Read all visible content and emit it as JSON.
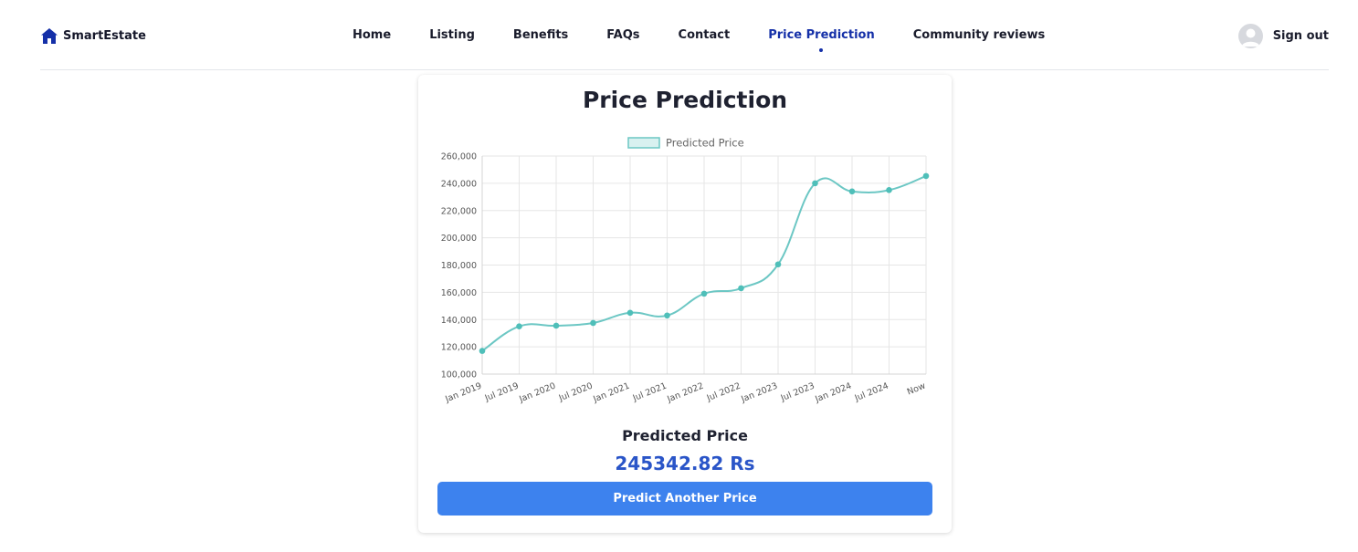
{
  "brand": {
    "name": "SmartEstate",
    "icon": "house-icon",
    "color": "#1530a8"
  },
  "nav": {
    "items": [
      {
        "label": "Home"
      },
      {
        "label": "Listing"
      },
      {
        "label": "Benefits"
      },
      {
        "label": "FAQs"
      },
      {
        "label": "Contact"
      },
      {
        "label": "Price Prediction",
        "active": true
      },
      {
        "label": "Community reviews"
      }
    ]
  },
  "user": {
    "avatar_icon": "user-avatar-icon",
    "signout_label": "Sign out"
  },
  "card": {
    "title": "Price Prediction",
    "predicted_label": "Predicted Price",
    "predicted_value": "245342.82 Rs",
    "button_label": "Predict Another Price"
  },
  "colors": {
    "accent": "#1530a8",
    "button": "#3d82ee",
    "value_text": "#2a55c8",
    "series_line": "#6cc7c4",
    "series_point": "#4fbfb9"
  },
  "chart_data": {
    "type": "line",
    "categories": [
      "Jan 2019",
      "Jul 2019",
      "Jan 2020",
      "Jul 2020",
      "Jan 2021",
      "Jul 2021",
      "Jan 2022",
      "Jul 2022",
      "Jan 2023",
      "Jul 2023",
      "Jan 2024",
      "Jul 2024",
      "Now"
    ],
    "series": [
      {
        "name": "Predicted Price",
        "values": [
          117000,
          135000,
          135500,
          137500,
          145000,
          143000,
          159000,
          163000,
          180500,
          240000,
          234000,
          235000,
          245342.82
        ]
      }
    ],
    "ylim": [
      100000,
      260000
    ],
    "yticks": [
      100000,
      120000,
      140000,
      160000,
      180000,
      200000,
      220000,
      240000,
      260000
    ],
    "ytick_labels": [
      "100,000",
      "120,000",
      "140,000",
      "160,000",
      "180,000",
      "200,000",
      "220,000",
      "240,000",
      "260,000"
    ],
    "grid": true,
    "legend": "top-center",
    "smooth": true
  }
}
